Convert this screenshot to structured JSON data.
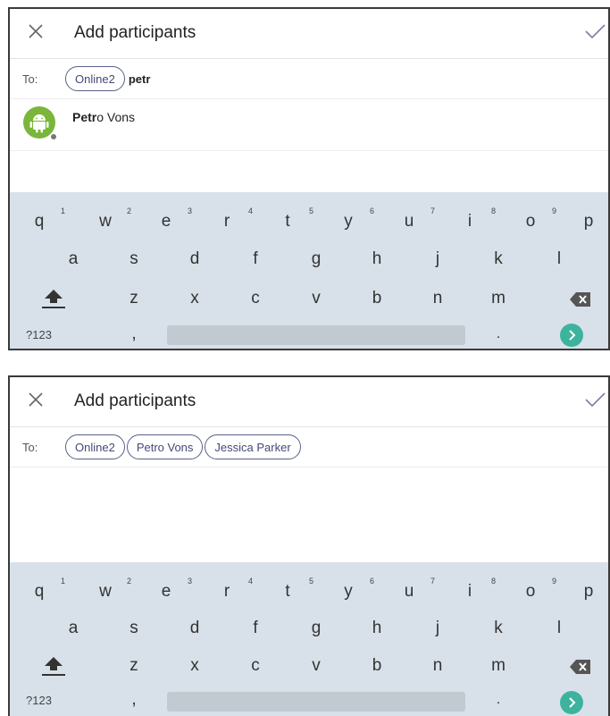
{
  "screens": [
    {
      "header": {
        "title": "Add participants"
      },
      "to_row": {
        "label": "To:",
        "chips": [
          "Online2"
        ],
        "typed_text": "petr"
      },
      "results": [
        {
          "match": "Petr",
          "rest": "o Vons"
        }
      ]
    },
    {
      "header": {
        "title": "Add participants"
      },
      "to_row": {
        "label": "To:",
        "chips": [
          "Online2",
          "Petro Vons",
          "Jessica Parker"
        ],
        "typed_text": ""
      }
    }
  ],
  "keyboard": {
    "row1": [
      "q",
      "w",
      "e",
      "r",
      "t",
      "y",
      "u",
      "i",
      "o",
      "p"
    ],
    "row1_numbers": [
      "1",
      "2",
      "3",
      "4",
      "5",
      "6",
      "7",
      "8",
      "9"
    ],
    "row2": [
      "a",
      "s",
      "d",
      "f",
      "g",
      "h",
      "j",
      "k",
      "l"
    ],
    "row3": [
      "z",
      "x",
      "c",
      "v",
      "b",
      "n",
      "m"
    ],
    "symbols_key": "?123",
    "comma_key": ",",
    "period_key": "."
  },
  "colors": {
    "accent": "#3db39e",
    "chip_border": "#5a5f8a",
    "keyboard_bg": "#d8e1ea",
    "avatar_bg": "#7bb53a"
  },
  "icons": {
    "close": "close-icon",
    "confirm": "checkmark-icon",
    "shift": "shift-arrow-icon",
    "backspace": "backspace-icon",
    "go": "chevron-right-icon",
    "avatar": "android-icon"
  }
}
